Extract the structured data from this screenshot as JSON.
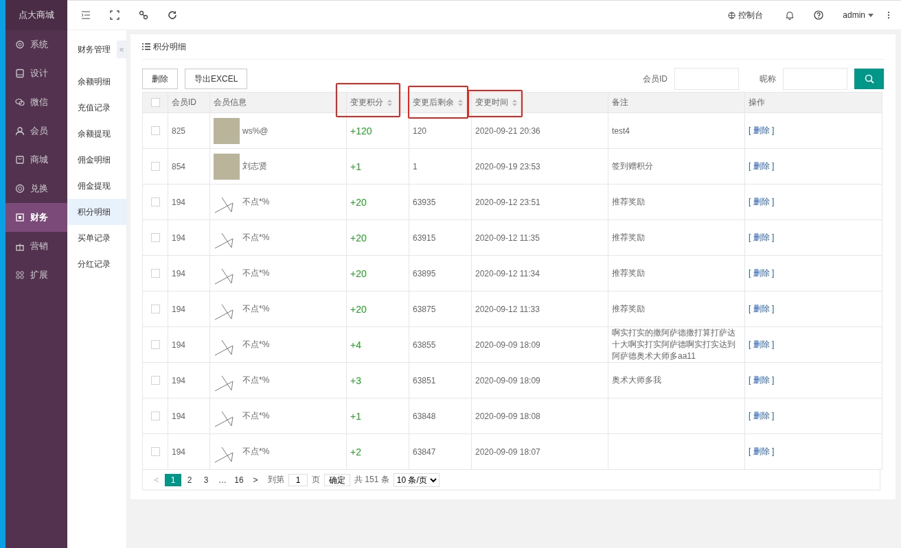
{
  "brand": "点大商城",
  "nav": [
    {
      "label": "系统",
      "kind": "gear",
      "selected": false
    },
    {
      "label": "设计",
      "kind": "monitor",
      "selected": false
    },
    {
      "label": "微信",
      "kind": "chat",
      "selected": false
    },
    {
      "label": "会员",
      "kind": "user",
      "selected": false
    },
    {
      "label": "商城",
      "kind": "bag",
      "selected": false
    },
    {
      "label": "兑换",
      "kind": "coin",
      "selected": false
    },
    {
      "label": "财务",
      "kind": "ledger",
      "selected": true
    },
    {
      "label": "营销",
      "kind": "gift",
      "selected": false
    },
    {
      "label": "扩展",
      "kind": "grid",
      "selected": false
    }
  ],
  "submenu": {
    "title": "财务管理",
    "collapse": "«",
    "items": [
      {
        "label": "余额明细",
        "selected": false
      },
      {
        "label": "充值记录",
        "selected": false
      },
      {
        "label": "余额提现",
        "selected": false
      },
      {
        "label": "佣金明细",
        "selected": false
      },
      {
        "label": "佣金提现",
        "selected": false
      },
      {
        "label": "积分明细",
        "selected": true
      },
      {
        "label": "买单记录",
        "selected": false
      },
      {
        "label": "分红记录",
        "selected": false
      }
    ]
  },
  "topbar": {
    "console": "控制台",
    "user": "admin"
  },
  "panel": {
    "title": "积分明细"
  },
  "toolbar": {
    "buttons": [
      "删除",
      "导出EXCEL"
    ],
    "filters": [
      {
        "label": "会员ID"
      },
      {
        "label": "昵称"
      }
    ]
  },
  "table": {
    "select_all_checked": false,
    "columns": [
      {
        "label": "会员ID",
        "sortable": false,
        "highlighted": false
      },
      {
        "label": "会员信息",
        "sortable": false,
        "highlighted": false
      },
      {
        "label": "变更积分",
        "sortable": true,
        "highlighted": true
      },
      {
        "label": "变更后剩余",
        "sortable": true,
        "highlighted": true
      },
      {
        "label": "变更时间",
        "sortable": true,
        "highlighted": true
      },
      {
        "label": "备注",
        "sortable": false,
        "highlighted": false
      },
      {
        "label": "操作",
        "sortable": false,
        "highlighted": false
      }
    ],
    "rows": [
      {
        "checked": false,
        "id": "825",
        "kind": "photo",
        "name": "ws%@",
        "change": "+120",
        "remain": "120",
        "time": "2020-09-21 20:36",
        "note": "test4",
        "action": "[ 删除 ]"
      },
      {
        "checked": false,
        "id": "854",
        "kind": "photo",
        "name": "刘志贤",
        "change": "+1",
        "remain": "1",
        "time": "2020-09-19 23:53",
        "note": "签到赠积分",
        "action": "[ 删除 ]"
      },
      {
        "checked": false,
        "id": "194",
        "kind": "sketch",
        "name": "不点*%",
        "change": "+20",
        "remain": "63935",
        "time": "2020-09-12 23:51",
        "note": "推荐奖励",
        "action": "[ 删除 ]"
      },
      {
        "checked": false,
        "id": "194",
        "kind": "sketch",
        "name": "不点*%",
        "change": "+20",
        "remain": "63915",
        "time": "2020-09-12 11:35",
        "note": "推荐奖励",
        "action": "[ 删除 ]"
      },
      {
        "checked": false,
        "id": "194",
        "kind": "sketch",
        "name": "不点*%",
        "change": "+20",
        "remain": "63895",
        "time": "2020-09-12 11:34",
        "note": "推荐奖励",
        "action": "[ 删除 ]"
      },
      {
        "checked": false,
        "id": "194",
        "kind": "sketch",
        "name": "不点*%",
        "change": "+20",
        "remain": "63875",
        "time": "2020-09-12 11:33",
        "note": "推荐奖励",
        "action": "[ 删除 ]"
      },
      {
        "checked": false,
        "id": "194",
        "kind": "sketch",
        "name": "不点*%",
        "change": "+4",
        "remain": "63855",
        "time": "2020-09-09 18:09",
        "note": "啊实打实的撒阿萨德撒打算打萨达十大啊实打实阿萨德啊实打实达到阿萨德奥术大师多aa11",
        "action": "[ 删除 ]"
      },
      {
        "checked": false,
        "id": "194",
        "kind": "sketch",
        "name": "不点*%",
        "change": "+3",
        "remain": "63851",
        "time": "2020-09-09 18:09",
        "note": "奥术大师多我",
        "action": "[ 删除 ]"
      },
      {
        "checked": false,
        "id": "194",
        "kind": "sketch",
        "name": "不点*%",
        "change": "+1",
        "remain": "63848",
        "time": "2020-09-09 18:08",
        "action": "[ 删除 ]"
      },
      {
        "checked": false,
        "id": "194",
        "kind": "sketch",
        "name": "不点*%",
        "change": "+2",
        "remain": "63847",
        "time": "2020-09-09 18:07",
        "action": "[ 删除 ]"
      }
    ]
  },
  "pagination": {
    "prev": "<",
    "pages": [
      {
        "label": "1",
        "selected": true
      },
      {
        "label": "2",
        "selected": false
      },
      {
        "label": "3",
        "selected": false
      },
      {
        "label": "…",
        "selected": false
      },
      {
        "label": "16",
        "selected": false
      }
    ],
    "next": ">",
    "goto_label": "到第",
    "goto_value": "1",
    "page_unit": "页",
    "confirm": "确定",
    "total": "共 151 条",
    "page_size": "10 条/页"
  }
}
